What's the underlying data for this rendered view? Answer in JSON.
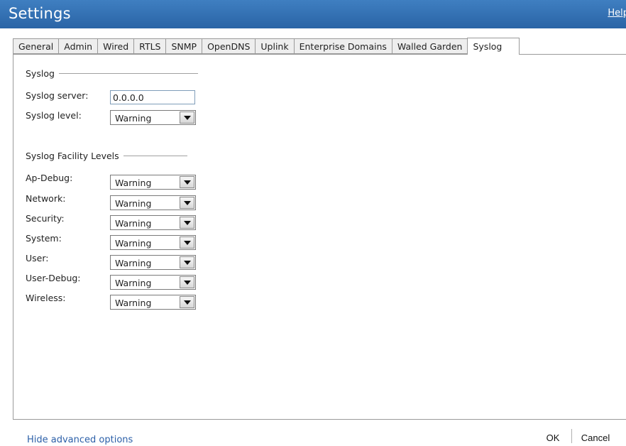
{
  "header": {
    "title": "Settings",
    "help": "Help"
  },
  "tabs": [
    {
      "label": "General",
      "active": false
    },
    {
      "label": "Admin",
      "active": false
    },
    {
      "label": "Wired",
      "active": false
    },
    {
      "label": "RTLS",
      "active": false
    },
    {
      "label": "SNMP",
      "active": false
    },
    {
      "label": "OpenDNS",
      "active": false
    },
    {
      "label": "Uplink",
      "active": false
    },
    {
      "label": "Enterprise Domains",
      "active": false
    },
    {
      "label": "Walled Garden",
      "active": false
    },
    {
      "label": "Syslog",
      "active": true
    }
  ],
  "syslog": {
    "section_title": "Syslog",
    "server_label": "Syslog server:",
    "server_value": "0.0.0.0",
    "level_label": "Syslog level:",
    "level_value": "Warning"
  },
  "facility": {
    "section_title": "Syslog Facility Levels",
    "rows": [
      {
        "label": "Ap-Debug:",
        "value": "Warning"
      },
      {
        "label": "Network:",
        "value": "Warning"
      },
      {
        "label": "Security:",
        "value": "Warning"
      },
      {
        "label": "System:",
        "value": "Warning"
      },
      {
        "label": "User:",
        "value": "Warning"
      },
      {
        "label": "User-Debug:",
        "value": "Warning"
      },
      {
        "label": "Wireless:",
        "value": "Warning"
      }
    ]
  },
  "footer": {
    "advanced_link": "Hide advanced options",
    "ok": "OK",
    "cancel": "Cancel"
  },
  "colors": {
    "title_bar": "#2f6db0",
    "link": "#2b5fa8"
  }
}
